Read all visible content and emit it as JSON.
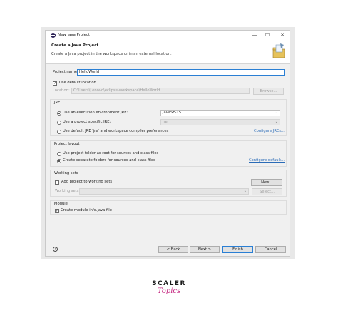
{
  "window": {
    "title": "New Java Project",
    "minimize": "—",
    "maximize": "☐",
    "close": "✕"
  },
  "header": {
    "title": "Create a Java Project",
    "description": "Create a Java project in the workspace or in an external location."
  },
  "project": {
    "name_label": "Project name:",
    "name_value": "HelloWorld"
  },
  "location": {
    "use_default_label": "Use default location",
    "use_default_checked": true,
    "label": "Location:",
    "value": "C:\\Users\\Lenovo\\eclipse-workspace\\HelloWorld",
    "browse": "Browse..."
  },
  "jre": {
    "group": "JRE",
    "option1": "Use an execution environment JRE:",
    "option1_value": "JavaSE-15",
    "option2": "Use a project specific JRE:",
    "option2_value": "jre",
    "option3": "Use default JRE 'jre' and workspace compiler preferences",
    "configure": "Configure JREs...",
    "selected": 1
  },
  "layout": {
    "group": "Project layout",
    "option1": "Use project folder as root for sources and class files",
    "option2": "Create separate folders for sources and class files",
    "configure": "Configure default...",
    "selected": 2
  },
  "working_sets": {
    "group": "Working sets",
    "add_label": "Add project to working sets",
    "add_checked": false,
    "new": "New...",
    "sets_label": "Working sets:",
    "select": "Select..."
  },
  "module": {
    "group": "Module",
    "create_label": "Create module-info.java file",
    "create_checked": true
  },
  "footer": {
    "help": "?",
    "back": "< Back",
    "next": "Next >",
    "finish": "Finish",
    "cancel": "Cancel"
  },
  "brand": {
    "top": "SCALER",
    "bottom": "Topics"
  },
  "colors": {
    "accent": "#2a7fd4",
    "link": "#2a6bb7",
    "brand_pink": "#c4247f"
  }
}
